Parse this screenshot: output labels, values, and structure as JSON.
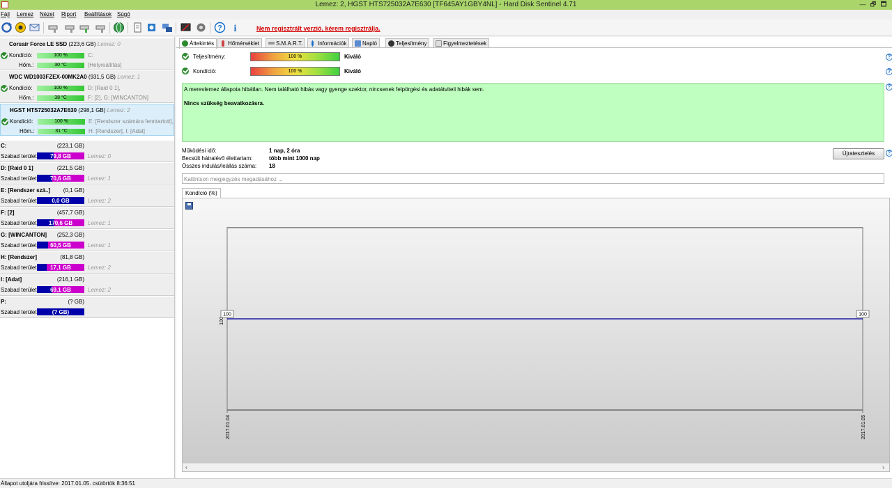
{
  "window": {
    "title": "Lemez: 2, HGST HTS725032A7E630 [TF645AY1GBY4NL]  -  Hard Disk Sentinel 4.71",
    "restore_glyph": "🗗",
    "maximize_glyph": "🗖"
  },
  "menu": [
    "Fájl",
    "Lemez",
    "Nézet",
    "Riport",
    "Beállítások",
    "Súgó"
  ],
  "toolbar": {
    "register_link": "Nem regisztrált verzió, kérem regisztrálja.",
    "help_glyph": "?",
    "info_glyph": "i"
  },
  "disks": [
    {
      "name": "Corsair Force LE SSD",
      "size": "(223,6 GB)",
      "lemez": "Lemez: 0",
      "kondicio_label": "Kondíció:",
      "kondicio": "100 %",
      "hom_label": "Hőm.:",
      "hom": "30 °C",
      "part1": "C:",
      "part2": "[Helyreállítás]"
    },
    {
      "name": "WDC WD1003FZEX-00MK2A0",
      "size": "(931,5 GB)",
      "lemez": "Lemez: 1",
      "kondicio_label": "Kondíció:",
      "kondicio": "100 %",
      "hom_label": "Hőm.:",
      "hom": "38 °C",
      "part1": "D: [Raid 0 1],",
      "part2": "F: [2], G: [WINCANTON]"
    },
    {
      "name": "HGST HTS725032A7E630",
      "size": "(298,1 GB)",
      "lemez": "Lemez: 2",
      "kondicio_label": "Kondíció:",
      "kondicio": "100 %",
      "hom_label": "Hőm.:",
      "hom": "31 °C",
      "part1": "E: [Rendszer számára fenntartott],",
      "part2": "H: [Rendszer], I: [Adat]"
    }
  ],
  "volumes": [
    {
      "name": "C:",
      "size": "(223,1 GB)",
      "free_label": "Szabad terület",
      "free": "79,8 GB",
      "fill": 0.36,
      "lemez": "Lemez: 0"
    },
    {
      "name": "D: [Raid 0 1]",
      "size": "(221,5 GB)",
      "free_label": "Szabad terület",
      "free": "70,6 GB",
      "fill": 0.32,
      "lemez": "Lemez: 1"
    },
    {
      "name": "E: [Rendszer szá..]",
      "size": "(0,1 GB)",
      "free_label": "Szabad terület",
      "free": "0,0 GB",
      "fill": 1.0,
      "lemez": "Lemez: 2"
    },
    {
      "name": "F: [2]",
      "size": "(457,7 GB)",
      "free_label": "Szabad terület",
      "free": "170,6 GB",
      "fill": 0.37,
      "lemez": "Lemez: 1"
    },
    {
      "name": "G: [WINCANTON]",
      "size": "(252,3 GB)",
      "free_label": "Szabad terület",
      "free": "60,5 GB",
      "fill": 0.24,
      "lemez": "Lemez: 1"
    },
    {
      "name": "H: [Rendszer]",
      "size": "(81,8 GB)",
      "free_label": "Szabad terület",
      "free": "17,1 GB",
      "fill": 0.21,
      "lemez": "Lemez: 2"
    },
    {
      "name": "I: [Adat]",
      "size": "(216,1 GB)",
      "free_label": "Szabad terület",
      "free": "69,1 GB",
      "fill": 0.32,
      "lemez": "Lemez: 2"
    },
    {
      "name": "P:",
      "size": "(? GB)",
      "free_label": "Szabad terület",
      "free": "(? GB)",
      "fill": 1.0,
      "lemez": ""
    }
  ],
  "tabs": [
    "Áttekintés",
    "Hőmérséklet",
    "S.M.A.R.T.",
    "Információk",
    "Napló",
    "Teljesítmény",
    "Figyelmeztetések"
  ],
  "overview": {
    "perf_label": "Teljesítmény:",
    "perf_value": "100 %",
    "perf_rating": "Kiváló",
    "cond_label": "Kondíció:",
    "cond_value": "100 %",
    "cond_rating": "Kiváló",
    "status_text": "A merevlemez állapota hibátlan. Nem található hibás vagy gyenge szektor, nincsenek felpörgési és adatátviteli hibák sem.",
    "action_text": "Nincs szükség beavatkozásra.",
    "uptime_label": "Működési idő:",
    "uptime": "1 nap, 2 óra",
    "life_label": "Becsült hátralévő élettartam:",
    "life": "több mint 1000 nap",
    "starts_label": "Összes indulás/leállás száma:",
    "starts": "18",
    "retest_button": "Újratesztelés",
    "comment_placeholder": "Kattintson megjegyzés megadásához ...",
    "chart_tab": "Kondíció  (%)"
  },
  "chart_data": {
    "type": "line",
    "x": [
      "2017.01.04",
      "2017.01.05"
    ],
    "series": [
      {
        "values": [
          100,
          100
        ]
      }
    ],
    "data_labels": [
      "100",
      "100"
    ],
    "ytick_label": "100",
    "ylim": [
      0,
      200
    ],
    "line_color": "#1a1aa8"
  },
  "statusbar": {
    "text": "Állapot utoljára frissítve: 2017.01.05. csütörtök 8:36:51"
  }
}
